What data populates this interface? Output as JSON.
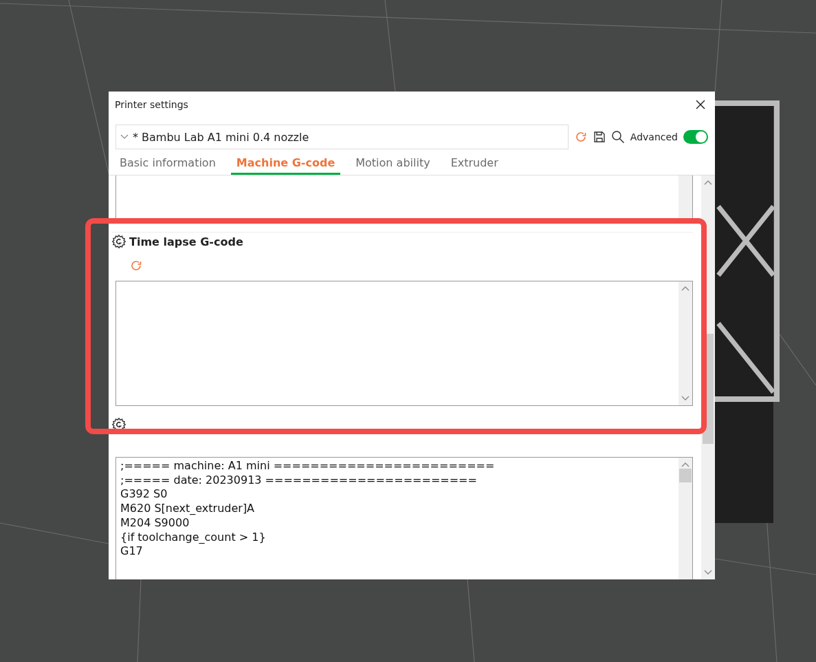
{
  "window": {
    "title": "Printer settings"
  },
  "preset": {
    "name": "* Bambu Lab A1 mini 0.4 nozzle"
  },
  "advanced": {
    "label": "Advanced",
    "on": true
  },
  "tabs": [
    {
      "label": "Basic information",
      "selected": false
    },
    {
      "label": "Machine G-code",
      "selected": true
    },
    {
      "label": "Motion ability",
      "selected": false
    },
    {
      "label": "Extruder",
      "selected": false
    }
  ],
  "time_lapse": {
    "title": "Time lapse G-code"
  },
  "change_filament": {
    "code": [
      ";===== machine: A1 mini ========================",
      ";===== date: 20230913 =======================",
      "G392 S0",
      "M620 S[next_extruder]A",
      "M204 S9000",
      "{if toolchange_count > 1}",
      "G17"
    ]
  }
}
